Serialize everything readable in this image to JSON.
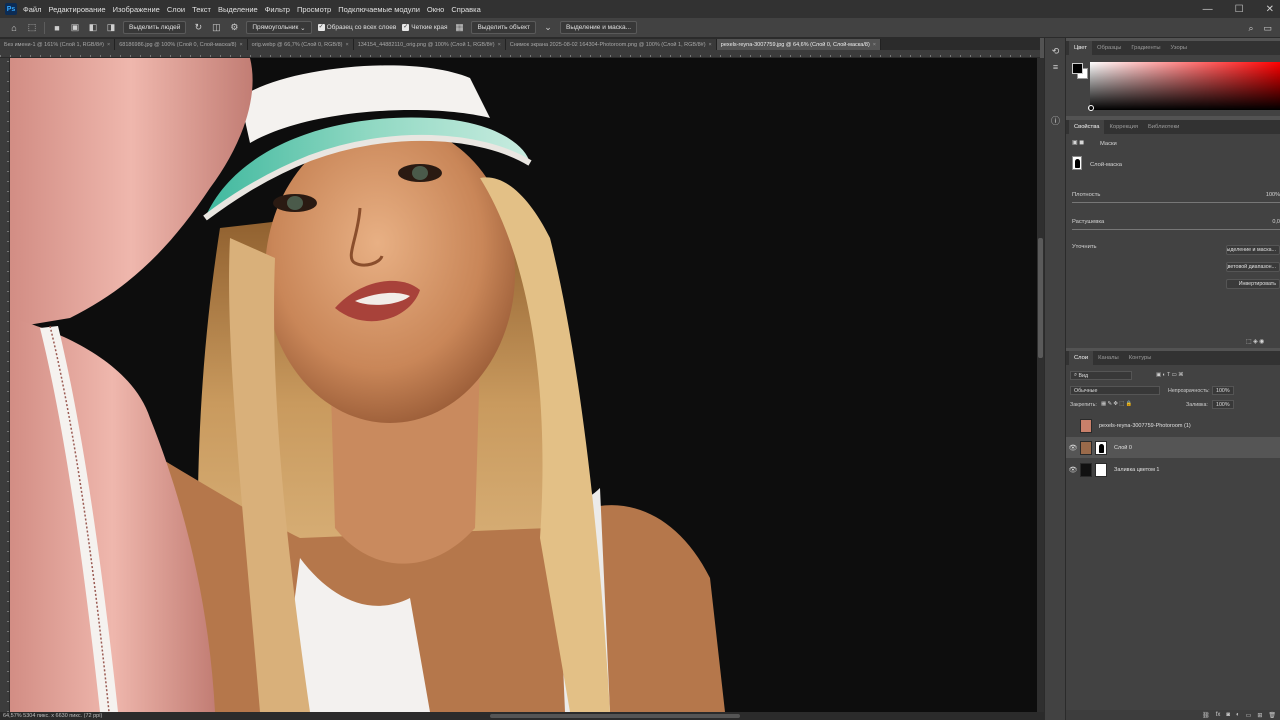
{
  "menu": [
    "Файл",
    "Редактирование",
    "Изображение",
    "Слои",
    "Текст",
    "Выделение",
    "Фильтр",
    "Просмотр",
    "Подключаемые модули",
    "Окно",
    "Справка"
  ],
  "app_logo": "Ps",
  "window_controls": {
    "minimize": "—",
    "maximize": "☐",
    "close": "✕"
  },
  "options": {
    "select_subject_btn": "Выделить людей",
    "mode_select": "Прямоугольник",
    "sample_all_layers": "Образец со всех слоев",
    "hard_edge": "Четкие края",
    "select_object_btn": "Выделить объект",
    "select_and_mask_btn": "Выделение и маска..."
  },
  "tabs": [
    {
      "label": "Без имени-1 @ 161% (Слой 1, RGB/8#)",
      "active": false
    },
    {
      "label": "68186986.jpg @ 100% (Слой 0, Слой-маска/8)",
      "active": false
    },
    {
      "label": "orig.webp @ 66,7% (Слой 0, RGB/8)",
      "active": false
    },
    {
      "label": "134154_44882110_orig.png @ 100% (Слой 1, RGB/8#)",
      "active": false
    },
    {
      "label": "Снимок экрана 2025-08-02 164304-Photoroom.png @ 100% (Слой 1, RGB/8#)",
      "active": false
    },
    {
      "label": "pexels-reyna-3007759.jpg @ 64,6% (Слой 0, Слой-маска/8)",
      "active": true
    }
  ],
  "status_bar": "64,57%    5304 пикс. x 6630 пикс. (72 ppi)",
  "color_panel": {
    "tabs": [
      "Цвет",
      "Образцы",
      "Градиенты",
      "Узоры"
    ],
    "active_tab": "Цвет",
    "foreground": "#000000",
    "background": "#ffffff",
    "hue": "#ff0000"
  },
  "properties": {
    "tabs": [
      "Свойства",
      "Коррекция",
      "Библиотеки"
    ],
    "active_tab": "Свойства",
    "masks_label": "Маски",
    "layer_mask_label": "Слой-маска",
    "density_label": "Плотность",
    "density_value": "100%",
    "feather_label": "Растушевка",
    "feather_value": "0,0",
    "refine_label": "Уточнить",
    "btn_select_mask": "Выделение и маска...",
    "btn_color_range": "Цветовой диапазон...",
    "btn_invert": "Инвертировать"
  },
  "layers": {
    "tabs": [
      "Слои",
      "Каналы",
      "Контуры"
    ],
    "active_tab": "Слои",
    "filter_label": "Вид",
    "blend_mode": "Обычные",
    "opacity_label": "Непрозрачность:",
    "opacity_value": "100%",
    "lock_label": "Закрепить:",
    "fill_label": "Заливка:",
    "fill_value": "100%",
    "items": [
      {
        "name": "pexels-reyna-3007759-Photoroom (1)",
        "visible": false,
        "selected": false
      },
      {
        "name": "Слой 0",
        "visible": true,
        "selected": true
      },
      {
        "name": "Заливка цветом 1",
        "visible": true,
        "selected": false
      }
    ]
  }
}
